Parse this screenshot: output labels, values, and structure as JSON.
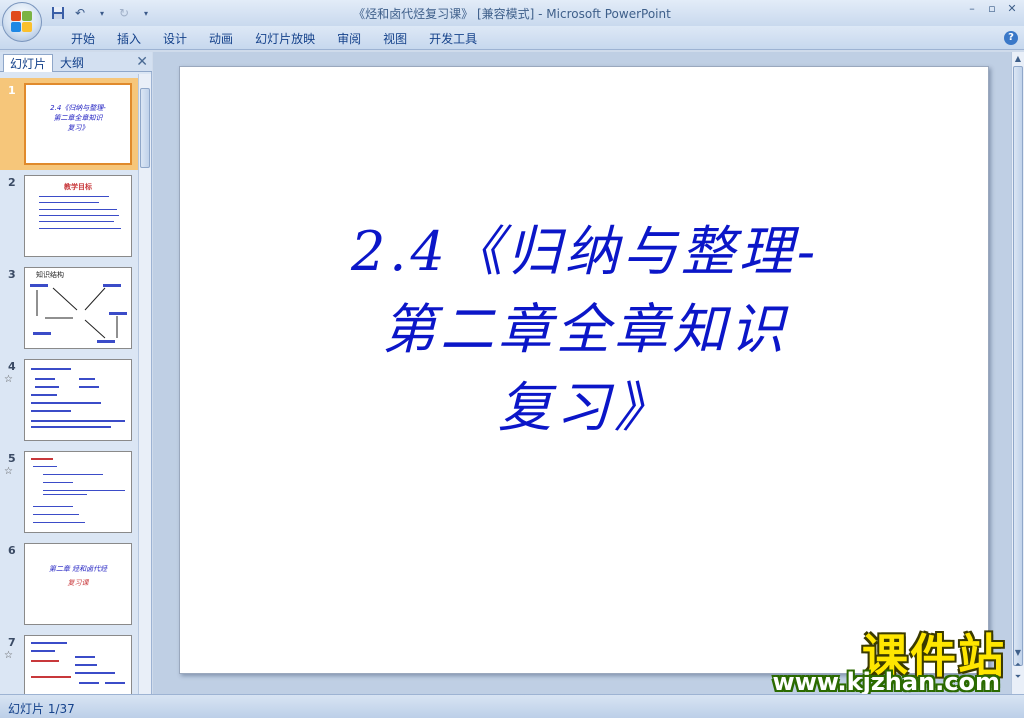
{
  "window": {
    "title": "《烃和卤代烃复习课》 [兼容模式] - Microsoft PowerPoint"
  },
  "ribbon": {
    "tabs": [
      "开始",
      "插入",
      "设计",
      "动画",
      "幻灯片放映",
      "审阅",
      "视图",
      "开发工具"
    ]
  },
  "panel": {
    "tab_slides": "幻灯片",
    "tab_outline": "大纲",
    "thumbnails": [
      {
        "num": "1",
        "lines": [
          "2.4《归纳与整理-",
          "第二章全章知识",
          "复习》"
        ]
      },
      {
        "num": "2",
        "heading": "教学目标"
      },
      {
        "num": "3",
        "heading": "知识结构"
      },
      {
        "num": "4"
      },
      {
        "num": "5"
      },
      {
        "num": "6",
        "lines": [
          "第二章 烃和卤代烃",
          "复习课"
        ]
      },
      {
        "num": "7"
      }
    ]
  },
  "slide": {
    "title_lines": [
      "2.4《归纳与整理-",
      "第二章全章知识",
      "复习》"
    ]
  },
  "status": {
    "slide_counter": "幻灯片 1/37"
  },
  "watermark": {
    "logo": "课件站",
    "url": "www.kjzhan.com"
  },
  "colors": {
    "title_text": "#0b16c8",
    "selected_thumb": "#f6c67a",
    "chrome": "#cfdbeb"
  }
}
